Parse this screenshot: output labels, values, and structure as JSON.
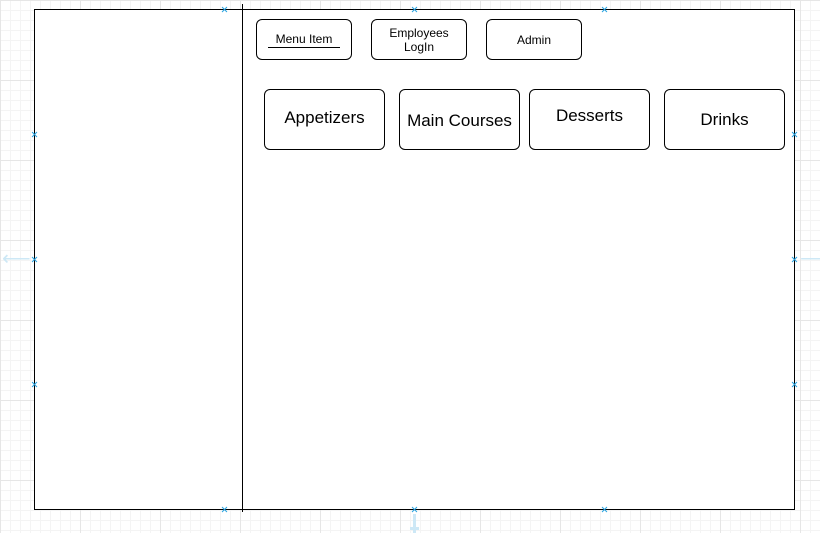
{
  "top_nav": {
    "menu_item": "Menu Item",
    "employees_line1": "Employees",
    "employees_line2": "LogIn",
    "admin": "Admin"
  },
  "categories": [
    {
      "label": "Appetizers"
    },
    {
      "label": "Main Courses"
    },
    {
      "label": "Desserts"
    },
    {
      "label": "Drinks"
    }
  ],
  "colors": {
    "handle": "#29a3e0",
    "grid": "#e6e6e6",
    "stroke": "#000000"
  }
}
